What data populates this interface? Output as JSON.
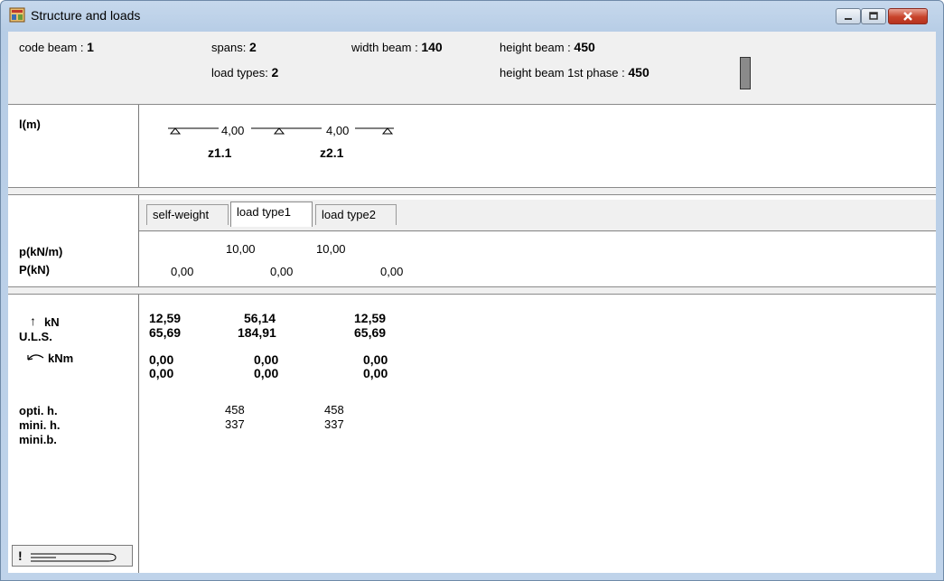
{
  "window": {
    "title": "Structure and loads"
  },
  "header": {
    "code_beam_label": "code beam :",
    "code_beam_value": "1",
    "spans_label": "spans:",
    "spans_value": "2",
    "load_types_label": "load types:",
    "load_types_value": "2",
    "width_label": "width beam :",
    "width_value": "140",
    "height_label": "height beam :",
    "height_value": "450",
    "height1_label": "height beam 1st phase :",
    "height1_value": "450"
  },
  "geometry": {
    "row_label": "l(m)",
    "span_lengths": [
      "4,00",
      "4,00"
    ],
    "span_names": [
      "z1.1",
      "z2.1"
    ]
  },
  "tabs": [
    {
      "label": "self-weight",
      "active": false
    },
    {
      "label": "load type1",
      "active": true
    },
    {
      "label": "load type2",
      "active": false
    }
  ],
  "loads": {
    "p_label": "p(kN/m)",
    "P_label": "P(kN)",
    "p_values": [
      "10,00",
      "10,00"
    ],
    "P_values": [
      "0,00",
      "0,00",
      "0,00"
    ]
  },
  "results": {
    "kn_label": "kN",
    "uls_label": "U.L.S.",
    "knm_label": "kNm",
    "reactions_row1": [
      "12,59",
      "56,14",
      "12,59"
    ],
    "reactions_row2": [
      "65,69",
      "184,91",
      "65,69"
    ],
    "moments_row1": [
      "0,00",
      "0,00",
      "0,00"
    ],
    "moments_row2": [
      "0,00",
      "0,00",
      "0,00"
    ],
    "opti_label": "opti. h.",
    "mini_h_label": "mini. h.",
    "mini_b_label": "mini.b.",
    "opti_values": [
      "458",
      "458"
    ],
    "mini_h_values": [
      "337",
      "337"
    ]
  },
  "corner_button_text": "!"
}
